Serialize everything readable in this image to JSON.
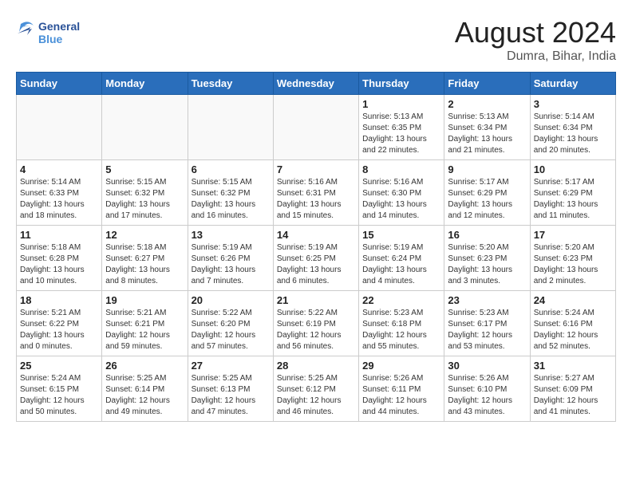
{
  "header": {
    "logo_general": "General",
    "logo_blue": "Blue",
    "month_year": "August 2024",
    "location": "Dumra, Bihar, India"
  },
  "days_of_week": [
    "Sunday",
    "Monday",
    "Tuesday",
    "Wednesday",
    "Thursday",
    "Friday",
    "Saturday"
  ],
  "weeks": [
    [
      {
        "day": "",
        "info": ""
      },
      {
        "day": "",
        "info": ""
      },
      {
        "day": "",
        "info": ""
      },
      {
        "day": "",
        "info": ""
      },
      {
        "day": "1",
        "info": "Sunrise: 5:13 AM\nSunset: 6:35 PM\nDaylight: 13 hours\nand 22 minutes."
      },
      {
        "day": "2",
        "info": "Sunrise: 5:13 AM\nSunset: 6:34 PM\nDaylight: 13 hours\nand 21 minutes."
      },
      {
        "day": "3",
        "info": "Sunrise: 5:14 AM\nSunset: 6:34 PM\nDaylight: 13 hours\nand 20 minutes."
      }
    ],
    [
      {
        "day": "4",
        "info": "Sunrise: 5:14 AM\nSunset: 6:33 PM\nDaylight: 13 hours\nand 18 minutes."
      },
      {
        "day": "5",
        "info": "Sunrise: 5:15 AM\nSunset: 6:32 PM\nDaylight: 13 hours\nand 17 minutes."
      },
      {
        "day": "6",
        "info": "Sunrise: 5:15 AM\nSunset: 6:32 PM\nDaylight: 13 hours\nand 16 minutes."
      },
      {
        "day": "7",
        "info": "Sunrise: 5:16 AM\nSunset: 6:31 PM\nDaylight: 13 hours\nand 15 minutes."
      },
      {
        "day": "8",
        "info": "Sunrise: 5:16 AM\nSunset: 6:30 PM\nDaylight: 13 hours\nand 14 minutes."
      },
      {
        "day": "9",
        "info": "Sunrise: 5:17 AM\nSunset: 6:29 PM\nDaylight: 13 hours\nand 12 minutes."
      },
      {
        "day": "10",
        "info": "Sunrise: 5:17 AM\nSunset: 6:29 PM\nDaylight: 13 hours\nand 11 minutes."
      }
    ],
    [
      {
        "day": "11",
        "info": "Sunrise: 5:18 AM\nSunset: 6:28 PM\nDaylight: 13 hours\nand 10 minutes."
      },
      {
        "day": "12",
        "info": "Sunrise: 5:18 AM\nSunset: 6:27 PM\nDaylight: 13 hours\nand 8 minutes."
      },
      {
        "day": "13",
        "info": "Sunrise: 5:19 AM\nSunset: 6:26 PM\nDaylight: 13 hours\nand 7 minutes."
      },
      {
        "day": "14",
        "info": "Sunrise: 5:19 AM\nSunset: 6:25 PM\nDaylight: 13 hours\nand 6 minutes."
      },
      {
        "day": "15",
        "info": "Sunrise: 5:19 AM\nSunset: 6:24 PM\nDaylight: 13 hours\nand 4 minutes."
      },
      {
        "day": "16",
        "info": "Sunrise: 5:20 AM\nSunset: 6:23 PM\nDaylight: 13 hours\nand 3 minutes."
      },
      {
        "day": "17",
        "info": "Sunrise: 5:20 AM\nSunset: 6:23 PM\nDaylight: 13 hours\nand 2 minutes."
      }
    ],
    [
      {
        "day": "18",
        "info": "Sunrise: 5:21 AM\nSunset: 6:22 PM\nDaylight: 13 hours\nand 0 minutes."
      },
      {
        "day": "19",
        "info": "Sunrise: 5:21 AM\nSunset: 6:21 PM\nDaylight: 12 hours\nand 59 minutes."
      },
      {
        "day": "20",
        "info": "Sunrise: 5:22 AM\nSunset: 6:20 PM\nDaylight: 12 hours\nand 57 minutes."
      },
      {
        "day": "21",
        "info": "Sunrise: 5:22 AM\nSunset: 6:19 PM\nDaylight: 12 hours\nand 56 minutes."
      },
      {
        "day": "22",
        "info": "Sunrise: 5:23 AM\nSunset: 6:18 PM\nDaylight: 12 hours\nand 55 minutes."
      },
      {
        "day": "23",
        "info": "Sunrise: 5:23 AM\nSunset: 6:17 PM\nDaylight: 12 hours\nand 53 minutes."
      },
      {
        "day": "24",
        "info": "Sunrise: 5:24 AM\nSunset: 6:16 PM\nDaylight: 12 hours\nand 52 minutes."
      }
    ],
    [
      {
        "day": "25",
        "info": "Sunrise: 5:24 AM\nSunset: 6:15 PM\nDaylight: 12 hours\nand 50 minutes."
      },
      {
        "day": "26",
        "info": "Sunrise: 5:25 AM\nSunset: 6:14 PM\nDaylight: 12 hours\nand 49 minutes."
      },
      {
        "day": "27",
        "info": "Sunrise: 5:25 AM\nSunset: 6:13 PM\nDaylight: 12 hours\nand 47 minutes."
      },
      {
        "day": "28",
        "info": "Sunrise: 5:25 AM\nSunset: 6:12 PM\nDaylight: 12 hours\nand 46 minutes."
      },
      {
        "day": "29",
        "info": "Sunrise: 5:26 AM\nSunset: 6:11 PM\nDaylight: 12 hours\nand 44 minutes."
      },
      {
        "day": "30",
        "info": "Sunrise: 5:26 AM\nSunset: 6:10 PM\nDaylight: 12 hours\nand 43 minutes."
      },
      {
        "day": "31",
        "info": "Sunrise: 5:27 AM\nSunset: 6:09 PM\nDaylight: 12 hours\nand 41 minutes."
      }
    ]
  ]
}
